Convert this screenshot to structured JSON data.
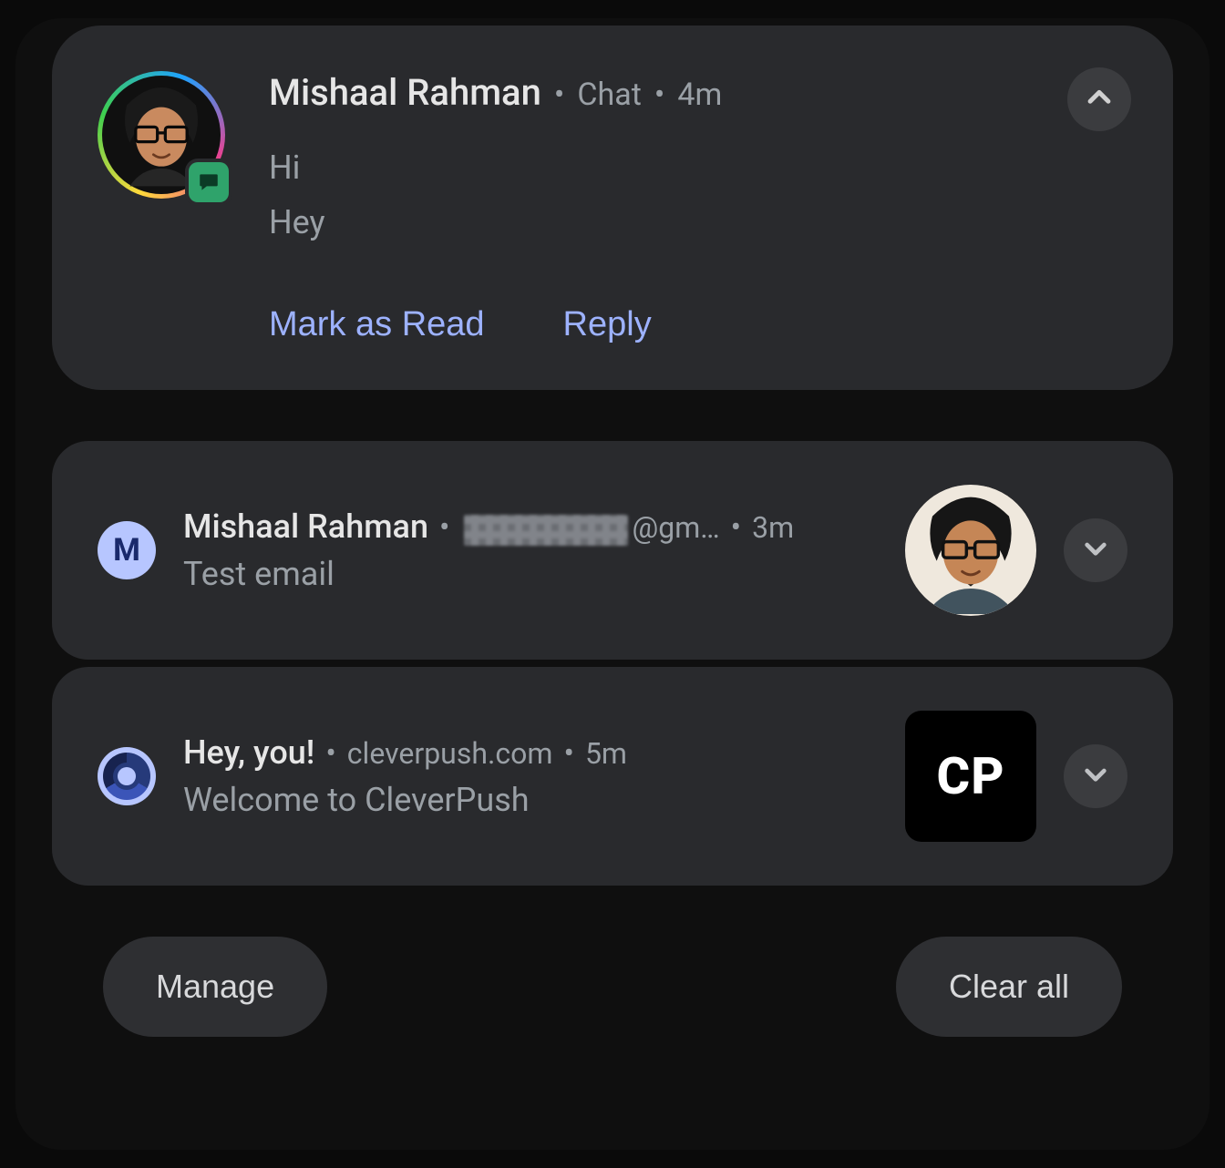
{
  "notifications": {
    "chat": {
      "sender": "Mishaal Rahman",
      "app": "Chat",
      "time": "4m",
      "messages": [
        "Hi",
        "Hey"
      ],
      "actions": {
        "mark_read": "Mark as Read",
        "reply": "Reply"
      }
    },
    "gmail": {
      "sender": "Mishaal Rahman",
      "email_suffix": "@gm…",
      "time": "3m",
      "subject": "Test email"
    },
    "chrome": {
      "title": "Hey, you!",
      "site": "cleverpush.com",
      "time": "5m",
      "body": "Welcome to CleverPush",
      "thumb_label": "CP"
    }
  },
  "footer": {
    "manage": "Manage",
    "clear_all": "Clear all"
  },
  "separator": "•"
}
